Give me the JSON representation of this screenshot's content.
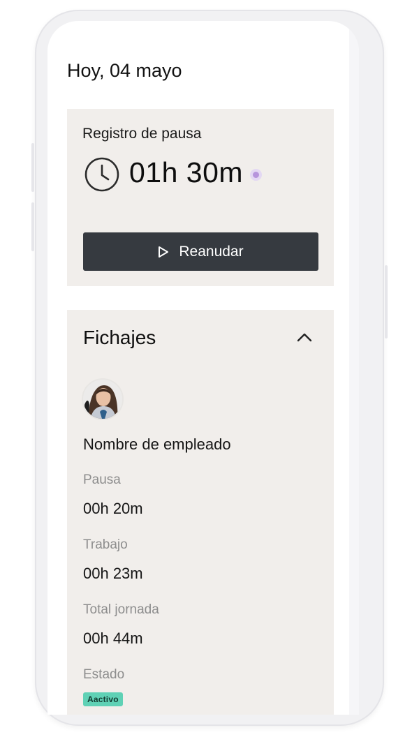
{
  "header": {
    "date_title": "Hoy, 04 mayo"
  },
  "break_card": {
    "label": "Registro de pausa",
    "clock_icon": "clock-icon",
    "elapsed": "01h 30m",
    "indicator_color": "#b694dc",
    "resume_button_label": "Reanudar",
    "resume_icon": "play-icon"
  },
  "entries": {
    "title": "Fichajes",
    "collapse_icon": "chevron-up-icon",
    "employee": {
      "name": "Nombre de empleado",
      "stats": [
        {
          "label": "Pausa",
          "value": "00h 20m"
        },
        {
          "label": "Trabajo",
          "value": "00h 23m"
        },
        {
          "label": "Total jornada",
          "value": "00h 44m"
        }
      ],
      "status_label": "Estado",
      "status_value": "Aactivo",
      "status_color": "#5fd1b5"
    }
  }
}
